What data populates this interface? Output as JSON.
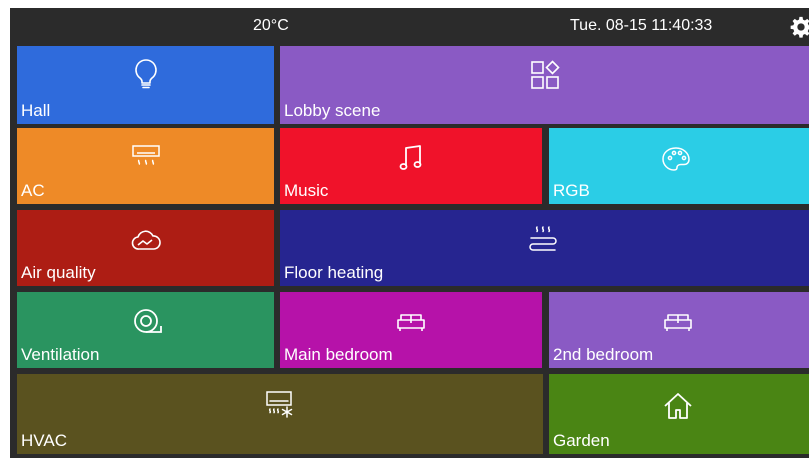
{
  "topbar": {
    "temperature": "20°C",
    "datetime": "Tue. 08-15 11:40:33",
    "settings_icon": "gear-icon"
  },
  "tiles": {
    "hall": {
      "label": "Hall",
      "icon": "lightbulb-icon",
      "color": "#2f6bdc"
    },
    "lobby_scene": {
      "label": "Lobby scene",
      "icon": "scene-grid-icon",
      "color": "#8a5ac4"
    },
    "ac": {
      "label": "AC",
      "icon": "air-conditioner-icon",
      "color": "#ee8a27"
    },
    "music": {
      "label": "Music",
      "icon": "music-note-icon",
      "color": "#f0122a"
    },
    "rgb": {
      "label": "RGB",
      "icon": "palette-icon",
      "color": "#2bcde6"
    },
    "air_quality": {
      "label": "Air quality",
      "icon": "cloud-icon",
      "color": "#ad1d14"
    },
    "floor_heating": {
      "label": "Floor heating",
      "icon": "floor-heating-icon",
      "color": "#262590"
    },
    "ventilation": {
      "label": "Ventilation",
      "icon": "fan-icon",
      "color": "#2a9460"
    },
    "main_bedroom": {
      "label": "Main bedroom",
      "icon": "sofa-icon",
      "color": "#b612a9"
    },
    "second_bedroom": {
      "label": "2nd bedroom",
      "icon": "sofa-icon",
      "color": "#8a5ac4"
    },
    "hvac": {
      "label": "HVAC",
      "icon": "hvac-icon",
      "color": "#5a521f"
    },
    "garden": {
      "label": "Garden",
      "icon": "home-icon",
      "color": "#4a8514"
    }
  }
}
